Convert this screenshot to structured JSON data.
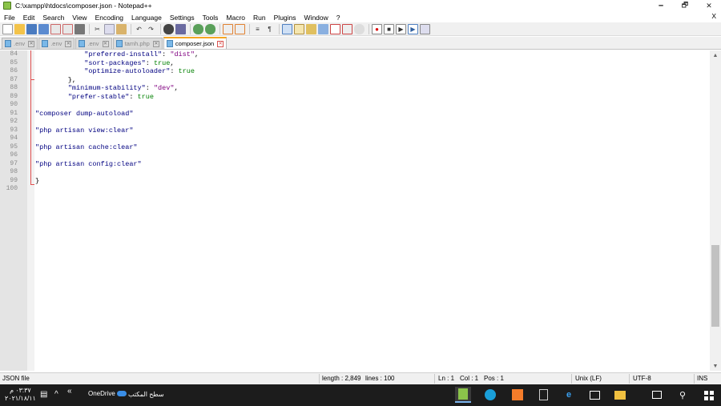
{
  "window": {
    "title": "C:\\xampp\\htdocs\\composer.json - Notepad++",
    "minimize": "🗕",
    "maximize": "🗗",
    "close": "✕"
  },
  "menu": {
    "items": [
      "File",
      "Edit",
      "Search",
      "View",
      "Encoding",
      "Language",
      "Settings",
      "Tools",
      "Macro",
      "Run",
      "Plugins",
      "Window",
      "?"
    ],
    "close": "X"
  },
  "toolbar": {
    "icons": [
      "new-icon",
      "open-icon",
      "save-icon",
      "save-all-icon",
      "close-icon",
      "close-all-icon",
      "print-icon",
      "cut-icon",
      "copy-icon",
      "paste-icon",
      "undo-icon",
      "redo-icon",
      "find-icon",
      "replace-icon",
      "zoom-in-icon",
      "zoom-out-icon",
      "sync-v-icon",
      "sync-h-icon",
      "word-wrap-icon",
      "show-all-chars-icon",
      "indent-guide-icon",
      "doc-map-icon",
      "function-list-icon",
      "folder-workspace-icon",
      "monitor-icon",
      "record-macro-icon",
      "stop-macro-icon",
      "play-macro-icon",
      "run-macro-icon",
      "save-macro-icon"
    ]
  },
  "tabs": [
    {
      "label": ".env",
      "active": false
    },
    {
      "label": ".env",
      "active": false
    },
    {
      "label": ".env",
      "active": false
    },
    {
      "label": "tamh.php",
      "active": false
    },
    {
      "label": "composer.json",
      "active": true
    }
  ],
  "editor": {
    "lines": [
      {
        "n": "84",
        "segs": [
          {
            "t": "            ",
            "c": "p"
          },
          {
            "t": "\"preferred-install\"",
            "c": "k"
          },
          {
            "t": ": ",
            "c": "p"
          },
          {
            "t": "\"dist\"",
            "c": "s"
          },
          {
            "t": ",",
            "c": "p"
          }
        ]
      },
      {
        "n": "85",
        "segs": [
          {
            "t": "            ",
            "c": "p"
          },
          {
            "t": "\"sort-packages\"",
            "c": "k"
          },
          {
            "t": ": ",
            "c": "p"
          },
          {
            "t": "true",
            "c": "b"
          },
          {
            "t": ",",
            "c": "p"
          }
        ]
      },
      {
        "n": "86",
        "segs": [
          {
            "t": "            ",
            "c": "p"
          },
          {
            "t": "\"optimize-autoloader\"",
            "c": "k"
          },
          {
            "t": ": ",
            "c": "p"
          },
          {
            "t": "true",
            "c": "b"
          }
        ]
      },
      {
        "n": "87",
        "segs": [
          {
            "t": "        },",
            "c": "p"
          }
        ]
      },
      {
        "n": "88",
        "segs": [
          {
            "t": "        ",
            "c": "p"
          },
          {
            "t": "\"minimum-stability\"",
            "c": "k"
          },
          {
            "t": ": ",
            "c": "p"
          },
          {
            "t": "\"dev\"",
            "c": "s"
          },
          {
            "t": ",",
            "c": "p"
          }
        ]
      },
      {
        "n": "89",
        "segs": [
          {
            "t": "        ",
            "c": "p"
          },
          {
            "t": "\"prefer-stable\"",
            "c": "k"
          },
          {
            "t": ": ",
            "c": "p"
          },
          {
            "t": "true",
            "c": "b"
          }
        ]
      },
      {
        "n": "90",
        "segs": []
      },
      {
        "n": "91",
        "segs": [
          {
            "t": "\"composer dump-autoload\"",
            "c": "k"
          }
        ]
      },
      {
        "n": "92",
        "segs": []
      },
      {
        "n": "93",
        "segs": [
          {
            "t": "\"php artisan view:clear\"",
            "c": "k"
          }
        ]
      },
      {
        "n": "94",
        "segs": []
      },
      {
        "n": "95",
        "segs": [
          {
            "t": "\"php artisan cache:clear\"",
            "c": "k"
          }
        ]
      },
      {
        "n": "96",
        "segs": []
      },
      {
        "n": "97",
        "segs": [
          {
            "t": "\"php artisan config:clear\"",
            "c": "k"
          }
        ]
      },
      {
        "n": "98",
        "segs": []
      },
      {
        "n": "99",
        "segs": [
          {
            "t": "}",
            "c": "p"
          }
        ]
      },
      {
        "n": "100",
        "segs": []
      }
    ]
  },
  "status": {
    "language": "JSON file",
    "length": "length : 2,849",
    "lines": "lines : 100",
    "ln": "Ln : 1",
    "col": "Col : 1",
    "pos": "Pos : 1",
    "eol": "Unix (LF)",
    "encoding": "UTF-8",
    "mode": "INS"
  },
  "taskbar": {
    "time": "٠٣:٣٧ م",
    "date": "٢٠٢١/١٨/١١",
    "onedrive": "OneDrive",
    "desktop": "سطح المكتب",
    "chevron": "«"
  }
}
